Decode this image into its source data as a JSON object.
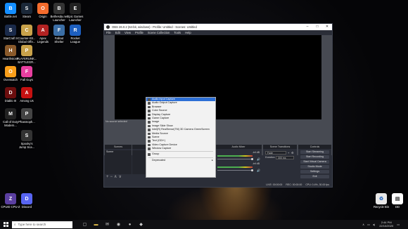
{
  "desktop": {
    "icons": [
      {
        "label": "Battle.net",
        "glyph": "B",
        "color": "#148eff"
      },
      {
        "label": "Steam",
        "glyph": "S",
        "color": "#1b2838"
      },
      {
        "label": "Origin",
        "glyph": "O",
        "color": "#f56c2d"
      },
      {
        "label": "Bethesda.net\nLauncher",
        "glyph": "B",
        "color": "#333"
      },
      {
        "label": "Epic Games\nLauncher",
        "glyph": "E",
        "color": "#222"
      },
      {
        "label": "StarCraft II",
        "glyph": "S",
        "color": "#1a2a4a"
      },
      {
        "label": "Counter-Str...\nGlobal Offe...",
        "glyph": "C",
        "color": "#c9a24a"
      },
      {
        "label": "Apex\nLegends",
        "glyph": "A",
        "color": "#b22222"
      },
      {
        "label": "Fallout\nShelter",
        "glyph": "F",
        "color": "#3b6ea5"
      },
      {
        "label": "Rocket\nLeague",
        "glyph": "R",
        "color": "#1d5fbf"
      },
      {
        "label": "Hearthstone",
        "glyph": "H",
        "color": "#8a5a2b"
      },
      {
        "label": "PLAYERUNK...\nBATTLEGR...",
        "glyph": "P",
        "color": "#c9a24a"
      },
      {
        "label": "Overwatch",
        "glyph": "O",
        "color": "#f99e1a"
      },
      {
        "label": "Fall Guys",
        "glyph": "F",
        "color": "#e83fa0"
      },
      {
        "label": "Diablo III",
        "glyph": "D",
        "color": "#6b0e0e"
      },
      {
        "label": "Among Us",
        "glyph": "A",
        "color": "#c51111"
      },
      {
        "label": "Call of Duty\nModern...",
        "glyph": "M",
        "color": "#222"
      },
      {
        "label": "Phasmoph...",
        "glyph": "P",
        "color": "#444"
      },
      {
        "label": "Spooky's\nJump Sca...",
        "glyph": "S",
        "color": "#333"
      },
      {
        "label": "CPUID CPU-Z",
        "glyph": "Z",
        "color": "#5b3fa0"
      },
      {
        "label": "Discord",
        "glyph": "D",
        "color": "#5865f2"
      },
      {
        "label": "Recycle Bin",
        "glyph": "♻",
        "color": "#3a3a3a"
      },
      {
        "label": "DD",
        "glyph": "D",
        "color": "#333"
      }
    ]
  },
  "obs": {
    "title": "OBS 26.0.2 (64-bit, windows) - Profile: Untitled - Scenes: Untitled",
    "menu": [
      "File",
      "Edit",
      "View",
      "Profile",
      "Scene Collection",
      "Tools",
      "Help"
    ],
    "no_source": "No source selected",
    "scenes_header": "Scenes",
    "sources_header": "Sources",
    "scene_item": "Scene",
    "mixer_header": "Audio Mixer",
    "mixer_db1": "-inf dB",
    "mixer_db2": "-inf dB",
    "transitions_header": "Scene Transitions",
    "transition_value": "Fade",
    "duration_label": "Duration",
    "duration_value": "300 ms",
    "controls_header": "Controls",
    "controls": [
      "Start Streaming",
      "Start Recording",
      "Start Virtual Camera",
      "Studio Mode",
      "Settings",
      "Exit"
    ],
    "status_live": "LIVE: 00:00:00",
    "status_rec": "REC: 00:00:00",
    "status_cpu": "CPU: 0.4%, 30.00 fps"
  },
  "context_menu": {
    "items": [
      "Audio Input Capture",
      "Audio Output Capture",
      "Browser",
      "Color Source",
      "Display Capture",
      "Game Capture",
      "Image",
      "Image Slide Show",
      "Intel(R) RealSense(TM) 3D Camera GreenScreen",
      "Media Source",
      "Scene",
      "Text (GDI+)",
      "Video Capture Device",
      "Window Capture"
    ],
    "group": "Group",
    "deprecated": "Deprecated"
  },
  "taskbar": {
    "search_placeholder": "Type here to search",
    "time": "2:44 PM",
    "date": "22/10/2020"
  }
}
